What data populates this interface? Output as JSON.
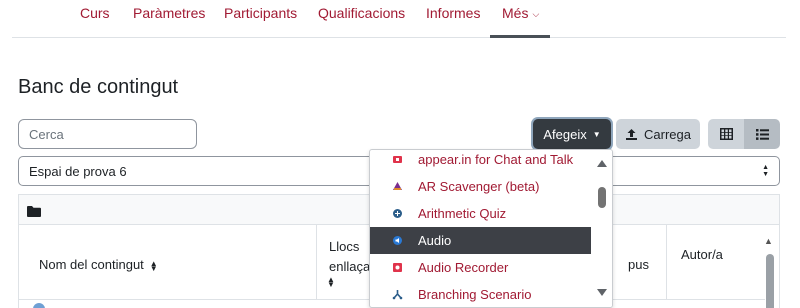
{
  "nav": {
    "items": [
      {
        "label": "Curs"
      },
      {
        "label": "Paràmetres"
      },
      {
        "label": "Participants"
      },
      {
        "label": "Qualificacions"
      },
      {
        "label": "Informes"
      },
      {
        "label": "Més",
        "active": true
      }
    ]
  },
  "page_title": "Banc de contingut",
  "search": {
    "placeholder": "Cerca",
    "value": ""
  },
  "toolbar": {
    "add_label": "Afegeix",
    "upload_label": "Carrega",
    "view_grid_icon": "grid-icon",
    "view_list_icon": "list-icon"
  },
  "context_select": {
    "selected": "Espai de prova 6"
  },
  "table": {
    "columns": [
      {
        "label": "Nom del contingut"
      },
      {
        "label": "Llocs enllaça"
      },
      {
        "label": "pus"
      },
      {
        "label": "Autor/a"
      }
    ]
  },
  "add_menu": {
    "items": [
      {
        "label": "appear.in for Chat and Talk",
        "icon": "appear-in-icon",
        "icon_color": "#e0334b"
      },
      {
        "label": "AR Scavenger (beta)",
        "icon": "ar-scavenger-icon",
        "icon_color": "#7b2d8e"
      },
      {
        "label": "Arithmetic Quiz",
        "icon": "arithmetic-quiz-icon",
        "icon_color": "#2b5d8a"
      },
      {
        "label": "Audio",
        "icon": "audio-icon",
        "icon_color": "#2a79d4",
        "highlighted": true
      },
      {
        "label": "Audio Recorder",
        "icon": "audio-recorder-icon",
        "icon_color": "#e0334b"
      },
      {
        "label": "Branching Scenario",
        "icon": "branching-scenario-icon",
        "icon_color": "#2b5d8a"
      }
    ]
  },
  "colors": {
    "brand": "#a11a33",
    "dark_button": "#343a40",
    "highlight": "#3d4046"
  }
}
